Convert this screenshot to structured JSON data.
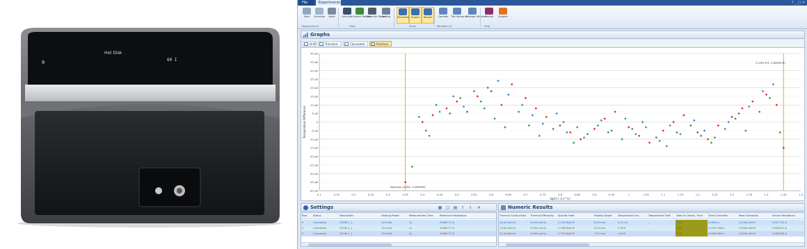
{
  "app": {
    "menu": {
      "file": "File",
      "experiments": "Experiments"
    },
    "ribbon": {
      "buttons": [
        {
          "id": "start",
          "label": "Start",
          "color": "#8fa7c4"
        },
        {
          "id": "schedule",
          "label": "Schedule",
          "color": "#9fb5d0"
        },
        {
          "id": "abort",
          "label": "Abort",
          "color": "#7a8aa1"
        },
        {
          "id": "calculate",
          "label": "Calculate",
          "color": "#3a4f6b"
        },
        {
          "id": "export",
          "label": "Export Results",
          "color": "#3c8a3a"
        },
        {
          "id": "report",
          "label": "Generate Report",
          "color": "#505b69"
        },
        {
          "id": "sorting",
          "label": "Sorting",
          "color": "#6b7f9a"
        },
        {
          "id": "parameters",
          "label": "Parameters",
          "color": "#3d6fb0"
        },
        {
          "id": "graphs",
          "label": "Graphs",
          "color": "#3d6fb0"
        },
        {
          "id": "results",
          "label": "Results",
          "color": "#3d6fb0"
        },
        {
          "id": "cascade",
          "label": "Cascade",
          "color": "#5f86bb"
        },
        {
          "id": "tile",
          "label": "Tile Horizontal",
          "color": "#5f86bb"
        },
        {
          "id": "change-window",
          "label": "Change Window",
          "color": "#5f86bb"
        },
        {
          "id": "manual",
          "label": "Manual",
          "color": "#8a2f6b"
        },
        {
          "id": "support",
          "label": "Support",
          "color": "#e0741f"
        }
      ],
      "groups": [
        "Measurement",
        "Tools",
        "Show",
        "Windows (2)",
        "Help"
      ]
    },
    "graphs": {
      "title": "Graphs",
      "tabs": [
        "Drift",
        "Transient",
        "Calculated",
        "Residual"
      ],
      "active_tab": "Residual"
    },
    "settings": {
      "title": "Settings",
      "columns": [
        "Row",
        "Status",
        "Description",
        "Heating Power",
        "Measurement Time",
        "Reference Resistance"
      ],
      "rows": [
        [
          "0",
          "Calculated",
          "23098 1_1",
          "120 mW",
          "2s",
          "5.860777 Ω"
        ],
        [
          "1",
          "Calculated",
          "23160 1_1",
          "120 mW",
          "2s",
          "5.860777 Ω"
        ],
        [
          "2",
          "Calculated",
          "23160 1_1",
          "120 mW",
          "2s",
          "5.860777 Ω"
        ]
      ]
    },
    "numeric": {
      "title": "Numeric Results",
      "columns": [
        "Thermal Conductivity",
        "Thermal Diffusivity",
        "Specific Heat",
        "Probing Depth",
        "Temperature Incr...",
        "Temperature Drift",
        "Total to Charac. Time",
        "Time Correction",
        "Mean Deviation",
        "Sensor Resistance"
      ],
      "rows": [
        [
          "13,81 W/m·K",
          "3.953 mm²/s",
          "2.155 MJ/m³K",
          "8.20 mm",
          "0.711 K",
          "-",
          "0.83",
          "0.0003 s",
          "3.576e-006 K",
          "5.857732 Ω"
        ],
        [
          "13,82 W/m·K",
          "3.934 mm²/s",
          "2.208 MJ/m³K",
          "8.15 mm",
          "1.39 K",
          "-",
          "0.33",
          "0.0155 996 s",
          "5.676e-006 K",
          "5.859422 Ω"
        ],
        [
          "13,34 W/m·K",
          "3.926 mm²/s",
          "1.775 MJ/m³K",
          "7.91 mm",
          "1.44 K",
          "-",
          "0.28",
          "0.0305 963 s",
          "3.673e-006 K",
          "5.862033 Ω"
        ]
      ]
    }
  },
  "chart_data": {
    "type": "scatter",
    "title": "",
    "xlabel": "Sqrt( t ) [s^½]",
    "ylabel": "Temperature Difference",
    "xlim": [
      0.1,
      1.5
    ],
    "ylim": [
      -40,
      40
    ],
    "xticks": [
      "0.1",
      "0.15",
      "0.2",
      "0.25",
      "0.3",
      "0.35",
      "0.4",
      "0.45",
      "0.5",
      "0.55",
      "0.6",
      "0.65",
      "0.7",
      "0.75",
      "0.8",
      "0.85",
      "0.9",
      "0.95",
      "1",
      "1.05",
      "1.1",
      "1.15",
      "1.2",
      "1.25",
      "1.3",
      "1.35",
      "1.4",
      "1.45",
      "1.5"
    ],
    "yticks": [
      "40 µK",
      "35 µK",
      "30 µK",
      "25 µK",
      "20 µK",
      "15 µK",
      "10 µK",
      "5 µK",
      "0",
      "-5 µK",
      "-10 µK",
      "-15 µK",
      "-20 µK",
      "-25 µK",
      "-30 µK",
      "-35 µK",
      "-40 µK"
    ],
    "grid": true,
    "markers": [
      {
        "x": 0.35,
        "label": "Selection (0.362, 0.00000M)"
      },
      {
        "x": 1.45,
        "label": "(1.455 471, 0.00000 M)"
      }
    ],
    "series": [
      {
        "color": "#e02828",
        "values": [
          [
            0.35,
            -35
          ],
          [
            0.4,
            0
          ],
          [
            0.43,
            4
          ],
          [
            0.47,
            8
          ],
          [
            0.5,
            12
          ],
          [
            0.53,
            6
          ],
          [
            0.56,
            15
          ],
          [
            0.6,
            18
          ],
          [
            0.63,
            10
          ],
          [
            0.66,
            22
          ],
          [
            0.7,
            14
          ],
          [
            0.73,
            8
          ],
          [
            0.76,
            3
          ],
          [
            0.8,
            -2
          ],
          [
            0.83,
            -6
          ],
          [
            0.86,
            -10
          ],
          [
            0.9,
            -4
          ],
          [
            0.93,
            2
          ],
          [
            0.96,
            6
          ],
          [
            1.0,
            -3
          ],
          [
            1.03,
            -8
          ],
          [
            1.06,
            -12
          ],
          [
            1.1,
            -5
          ],
          [
            1.13,
            0
          ],
          [
            1.16,
            4
          ],
          [
            1.2,
            -6
          ],
          [
            1.23,
            -10
          ],
          [
            1.26,
            -2
          ],
          [
            1.3,
            3
          ],
          [
            1.33,
            8
          ],
          [
            1.36,
            12
          ],
          [
            1.4,
            16
          ],
          [
            1.43,
            10
          ],
          [
            1.45,
            -15
          ]
        ]
      },
      {
        "color": "#2e9a3a",
        "values": [
          [
            0.37,
            -26
          ],
          [
            0.41,
            -5
          ],
          [
            0.44,
            10
          ],
          [
            0.48,
            5
          ],
          [
            0.51,
            14
          ],
          [
            0.55,
            18
          ],
          [
            0.58,
            8
          ],
          [
            0.61,
            2
          ],
          [
            0.64,
            -3
          ],
          [
            0.68,
            6
          ],
          [
            0.71,
            -2
          ],
          [
            0.74,
            -8
          ],
          [
            0.78,
            -4
          ],
          [
            0.81,
            0
          ],
          [
            0.84,
            -12
          ],
          [
            0.88,
            -7
          ],
          [
            0.91,
            -2
          ],
          [
            0.94,
            -6
          ],
          [
            0.98,
            -10
          ],
          [
            1.01,
            -4
          ],
          [
            1.04,
            0
          ],
          [
            1.08,
            -9
          ],
          [
            1.11,
            -14
          ],
          [
            1.14,
            -6
          ],
          [
            1.18,
            -2
          ],
          [
            1.21,
            -8
          ],
          [
            1.24,
            -12
          ],
          [
            1.28,
            -4
          ],
          [
            1.31,
            2
          ],
          [
            1.34,
            -5
          ],
          [
            1.38,
            6
          ],
          [
            1.41,
            14
          ],
          [
            1.44,
            -6
          ]
        ]
      },
      {
        "color": "#3f7fd0",
        "values": [
          [
            0.39,
            3
          ],
          [
            0.42,
            -8
          ],
          [
            0.45,
            6
          ],
          [
            0.49,
            15
          ],
          [
            0.52,
            9
          ],
          [
            0.57,
            12
          ],
          [
            0.59,
            20
          ],
          [
            0.62,
            24
          ],
          [
            0.65,
            16
          ],
          [
            0.69,
            10
          ],
          [
            0.72,
            4
          ],
          [
            0.75,
            -1
          ],
          [
            0.79,
            5
          ],
          [
            0.82,
            -6
          ],
          [
            0.85,
            -3
          ],
          [
            0.87,
            -9
          ],
          [
            0.92,
            1
          ],
          [
            0.95,
            -5
          ],
          [
            0.99,
            2
          ],
          [
            1.02,
            -7
          ],
          [
            1.05,
            -3
          ],
          [
            1.09,
            -11
          ],
          [
            1.12,
            -2
          ],
          [
            1.15,
            -7
          ],
          [
            1.19,
            1
          ],
          [
            1.22,
            -5
          ],
          [
            1.25,
            -9
          ],
          [
            1.29,
            0
          ],
          [
            1.32,
            5
          ],
          [
            1.35,
            9
          ],
          [
            1.39,
            18
          ],
          [
            1.42,
            22
          ]
        ]
      }
    ]
  }
}
